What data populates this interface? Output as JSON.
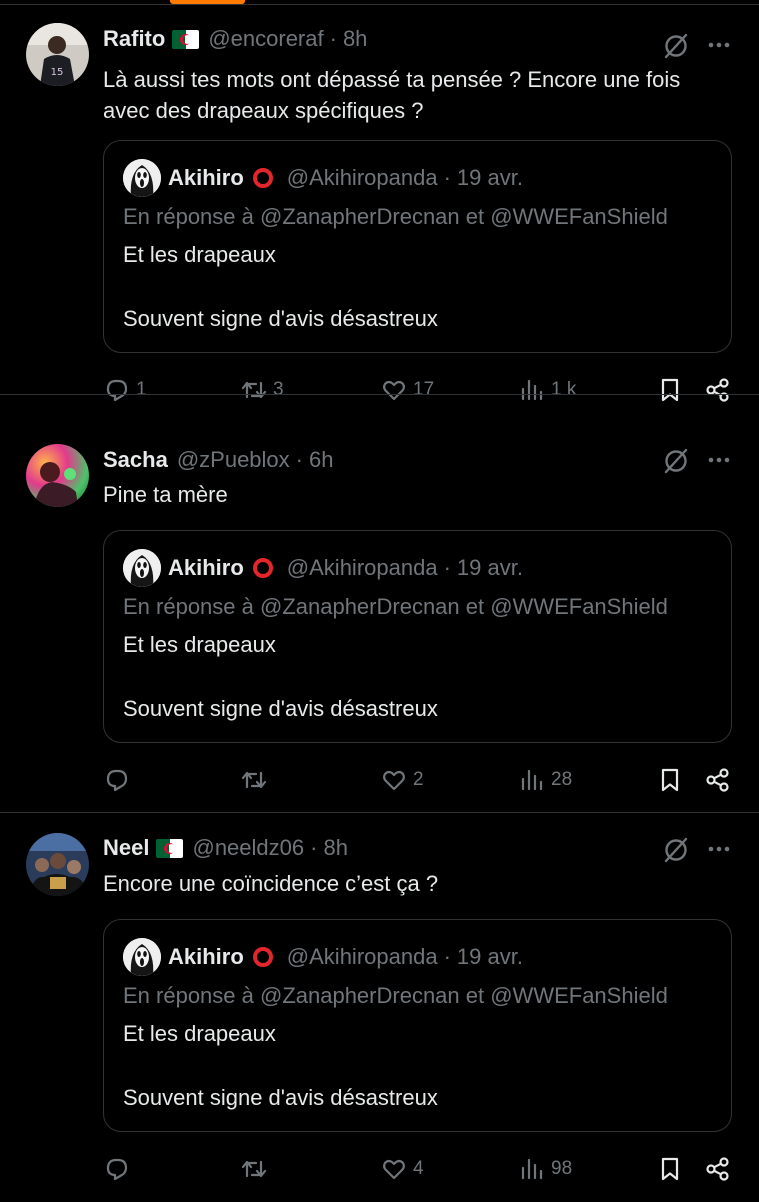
{
  "tweets": [
    {
      "name": "Rafito",
      "handle": "@encoreraf",
      "sep": "·",
      "time": "8h",
      "has_flag": true,
      "text_lines": [
        "Là aussi tes mots ont dépassé ta pensée ? Encore une fois",
        "avec des drapeaux spécifiques ?"
      ],
      "quote": {
        "name": "Akihiro",
        "handle": "@Akihiropanda",
        "sep": "·",
        "date": "19 avr.",
        "reply_to": "En réponse à @ZanapherDrecnan  et  @WWEFanShield",
        "line1": "Et les drapeaux",
        "line2": "Souvent signe d'avis désastreux"
      },
      "actions": {
        "replies": "1",
        "reposts": "3",
        "likes": "17",
        "views": "1 k"
      }
    },
    {
      "name": "Sacha",
      "handle": "@zPueblox",
      "sep": "·",
      "time": "6h",
      "has_flag": false,
      "text_lines": [
        "Pine ta mère"
      ],
      "quote": {
        "name": "Akihiro",
        "handle": "@Akihiropanda",
        "sep": "·",
        "date": "19 avr.",
        "reply_to": "En réponse à @ZanapherDrecnan  et  @WWEFanShield",
        "line1": "Et les drapeaux",
        "line2": "Souvent signe d'avis désastreux"
      },
      "actions": {
        "replies": "",
        "reposts": "",
        "likes": "2",
        "views": "28"
      }
    },
    {
      "name": "Neel",
      "handle": "@neeldz06",
      "sep": "·",
      "time": "8h",
      "has_flag": true,
      "text_lines": [
        "Encore une coïncidence c’est ça ?"
      ],
      "quote": {
        "name": "Akihiro",
        "handle": "@Akihiropanda",
        "sep": "·",
        "date": "19 avr.",
        "reply_to": "En réponse à @ZanapherDrecnan  et  @WWEFanShield",
        "line1": "Et les drapeaux",
        "line2": "Souvent signe d'avis désastreux"
      },
      "actions": {
        "replies": "",
        "reposts": "",
        "likes": "4",
        "views": "98"
      }
    }
  ],
  "colors": {
    "background": "#000000",
    "text": "#e7e9ea",
    "muted": "#71767b",
    "border": "#2f3336",
    "accent_bar": "#ff7a00",
    "ring": "#e3252c"
  },
  "icons": [
    "grok-icon",
    "more-icon",
    "reply-icon",
    "repost-icon",
    "like-icon",
    "views-icon",
    "bookmark-icon",
    "share-icon"
  ]
}
